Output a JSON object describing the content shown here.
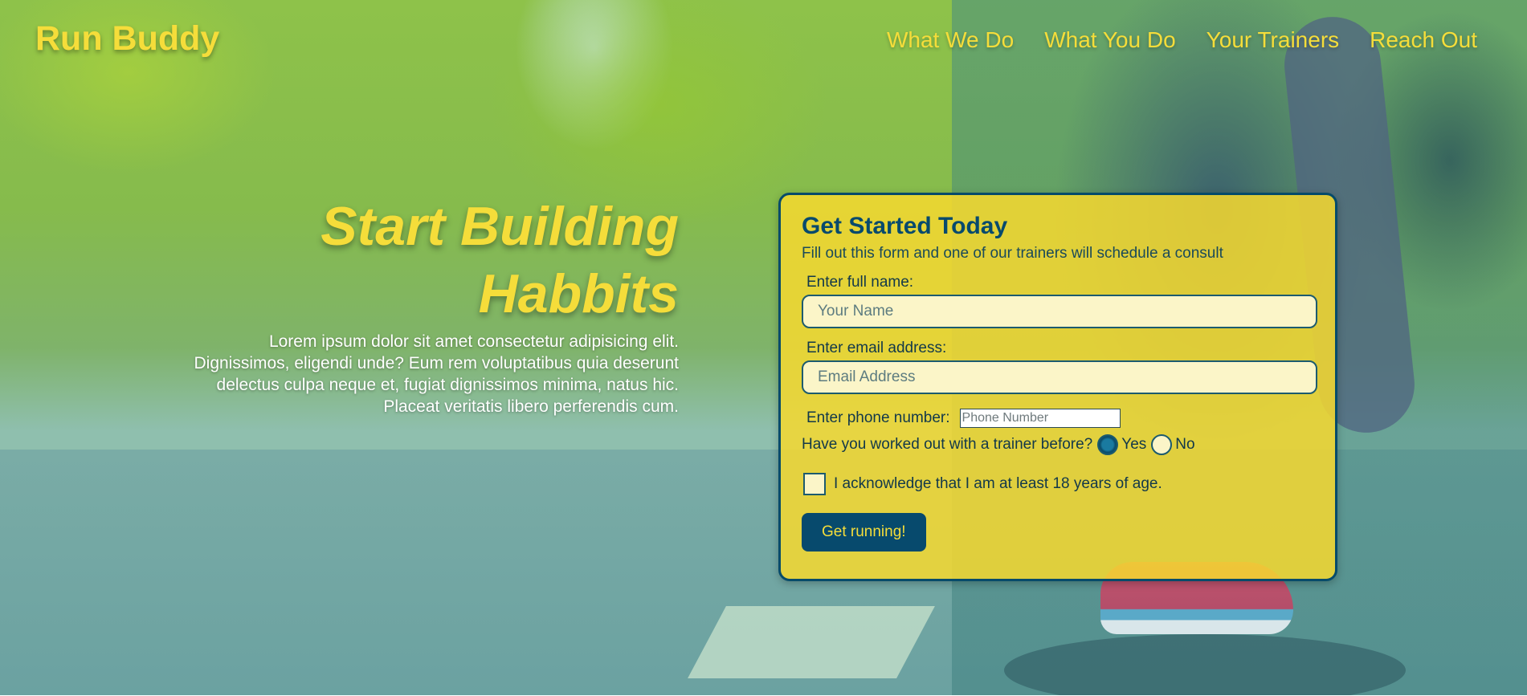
{
  "header": {
    "logo": "Run Buddy",
    "nav": [
      {
        "label": "What We Do"
      },
      {
        "label": "What You Do"
      },
      {
        "label": "Your Trainers"
      },
      {
        "label": "Reach Out"
      }
    ]
  },
  "hero": {
    "title": "Start Building Habbits",
    "body": "Lorem ipsum dolor sit amet consectetur adipisicing elit. Dignissimos, eligendi unde? Eum rem voluptatibus quia deserunt delectus culpa neque et, fugiat dignissimos minima, natus hic. Placeat veritatis libero perferendis cum."
  },
  "form": {
    "title": "Get Started Today",
    "subtitle": "Fill out this form and one of our trainers will schedule a consult",
    "name_label": "Enter full name:",
    "name_placeholder": "Your Name",
    "email_label": "Enter email address:",
    "email_placeholder": "Email Address",
    "phone_label": "Enter phone number:",
    "phone_placeholder": "Phone Number",
    "trainer_question": "Have you worked out with a trainer before?",
    "yes_label": "Yes",
    "no_label": "No",
    "yes_selected": true,
    "age_ack": "I acknowledge that I am at least 18 years of age.",
    "age_checked": false,
    "submit_label": "Get running!"
  },
  "colors": {
    "accent_yellow": "#f5dd3a",
    "primary_navy": "#074a6d"
  }
}
